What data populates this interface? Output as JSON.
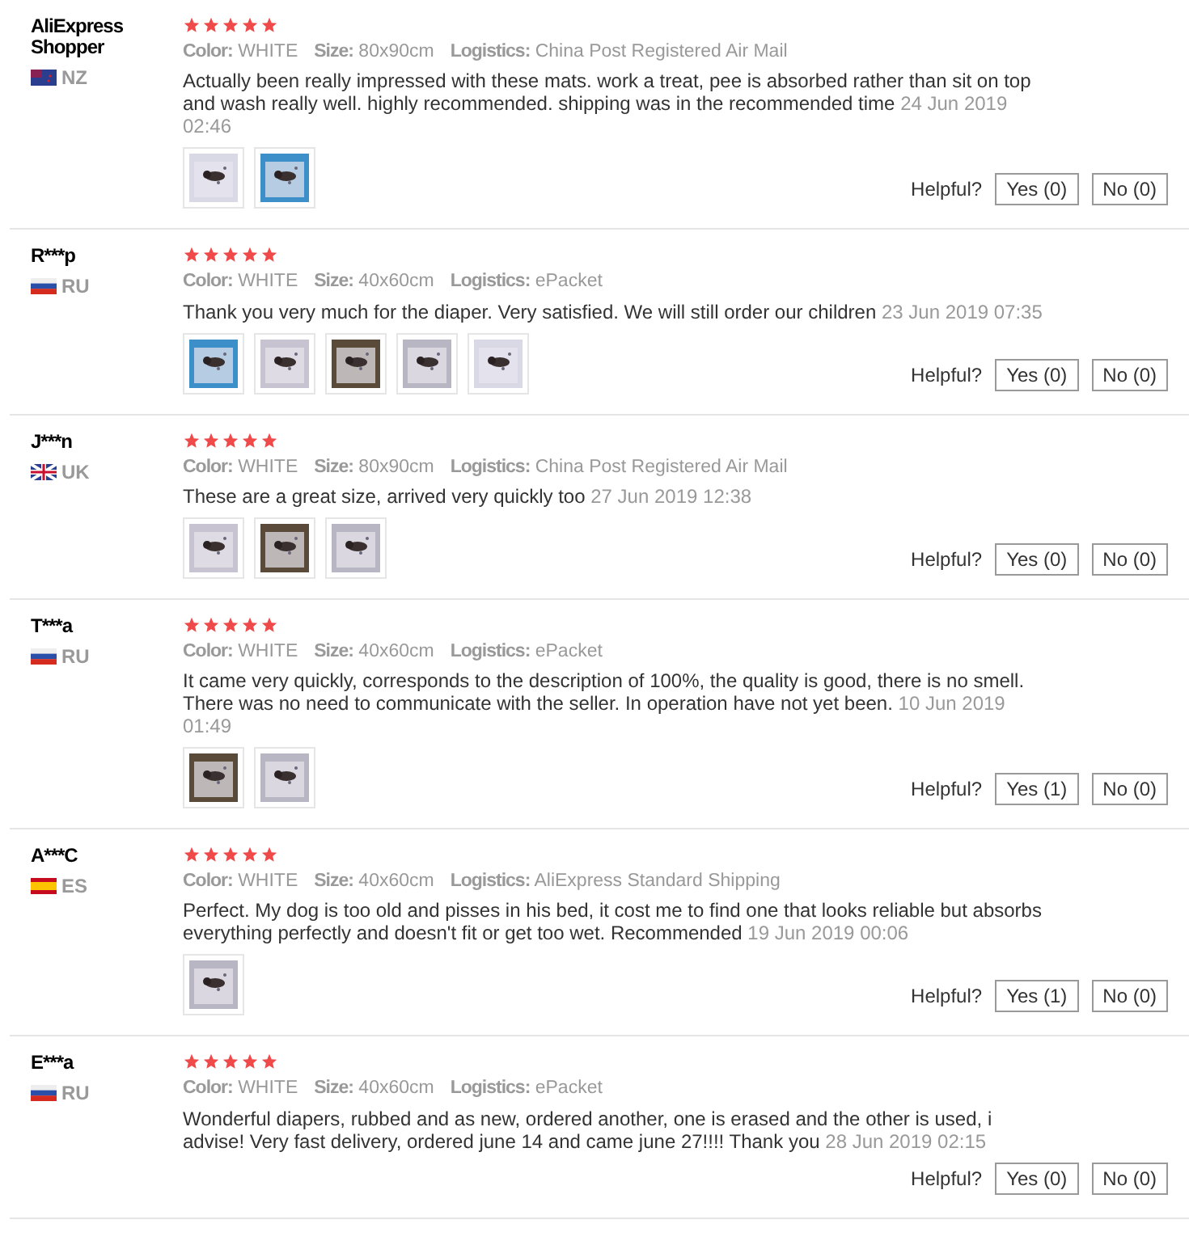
{
  "reviews": [
    {
      "name": "AliExpress Shopper",
      "kind": "nz",
      "country": "NZ",
      "stars": 5,
      "color_label": "Color:",
      "color_value": "WHITE",
      "size_label": "Size:",
      "size": "80x90cm",
      "logistics_label": "Logistics:",
      "logistics": "China Post Registered Air Mail",
      "text": "Actually been really impressed with these mats. work a treat, pee is absorbed rather than sit on top and wash really well. highly recommended. shipping was in the recommended time",
      "date": "24 Jun 2019 02:46",
      "photos": [
        {
          "kind": "picture"
        },
        {
          "kind": "picture"
        }
      ],
      "helpful": "Helpful?",
      "yes": "Yes (0)",
      "no": "No (0)"
    },
    {
      "name": "R***p",
      "kind": "ru",
      "country": "RU",
      "stars": 5,
      "color_label": "Color:",
      "color_value": "WHITE",
      "size_label": "Size:",
      "size": "40x60cm",
      "logistics_label": "Logistics:",
      "logistics": "ePacket",
      "text": "Thank you very much for the diaper. Very satisfied. We will still order our children",
      "date": "23 Jun 2019 07:35",
      "photos": [
        {
          "kind": "picture"
        },
        {
          "kind": "picture"
        },
        {
          "kind": "picture"
        },
        {
          "kind": "picture"
        },
        {
          "kind": "picture"
        }
      ],
      "helpful": "Helpful?",
      "yes": "Yes (0)",
      "no": "No (0)"
    },
    {
      "name": "J***n",
      "kind": "uk",
      "country": "UK",
      "stars": 5,
      "color_label": "Color:",
      "color_value": "WHITE",
      "size_label": "Size:",
      "size": "80x90cm",
      "logistics_label": "Logistics:",
      "logistics": "China Post Registered Air Mail",
      "text": "These are a great size, arrived very quickly too",
      "date": "27 Jun 2019 12:38",
      "photos": [
        {
          "kind": "picture"
        },
        {
          "kind": "picture"
        },
        {
          "kind": "picture"
        }
      ],
      "helpful": "Helpful?",
      "yes": "Yes (0)",
      "no": "No (0)"
    },
    {
      "name": "T***a",
      "kind": "ru",
      "country": "RU",
      "stars": 5,
      "color_label": "Color:",
      "color_value": "WHITE",
      "size_label": "Size:",
      "size": "40x60cm",
      "logistics_label": "Logistics:",
      "logistics": "ePacket",
      "text": "It came very quickly, corresponds to the description of 100%, the quality is good, there is no smell. There was no need to communicate with the seller. In operation have not yet been.",
      "date": "10 Jun 2019 01:49",
      "photos": [
        {
          "kind": "picture"
        },
        {
          "kind": "picture"
        }
      ],
      "helpful": "Helpful?",
      "yes": "Yes (1)",
      "no": "No (0)"
    },
    {
      "name": "A***C",
      "kind": "es",
      "country": "ES",
      "stars": 5,
      "color_label": "Color:",
      "color_value": "WHITE",
      "size_label": "Size:",
      "size": "40x60cm",
      "logistics_label": "Logistics:",
      "logistics": "AliExpress Standard Shipping",
      "text": "Perfect. My dog is too old and pisses in his bed, it cost me to find one that looks reliable but absorbs everything perfectly and doesn't fit or get too wet. Recommended",
      "date": "19 Jun 2019 00:06",
      "photos": [
        {
          "kind": "picture"
        }
      ],
      "helpful": "Helpful?",
      "yes": "Yes (1)",
      "no": "No (0)"
    },
    {
      "name": "E***a",
      "kind": "ru",
      "country": "RU",
      "stars": 5,
      "color_label": "Color:",
      "color_value": "WHITE",
      "size_label": "Size:",
      "size": "40x60cm",
      "logistics_label": "Logistics:",
      "logistics": "ePacket",
      "text": "Wonderful diapers, rubbed and as new, ordered another, one is erased and the other is used, i advise! Very fast delivery, ordered june 14 and came june 27!!!! Thank you",
      "date": "28 Jun 2019 02:15",
      "helpful": "Helpful?",
      "yes": "Yes (0)",
      "no": "No (0)"
    }
  ]
}
